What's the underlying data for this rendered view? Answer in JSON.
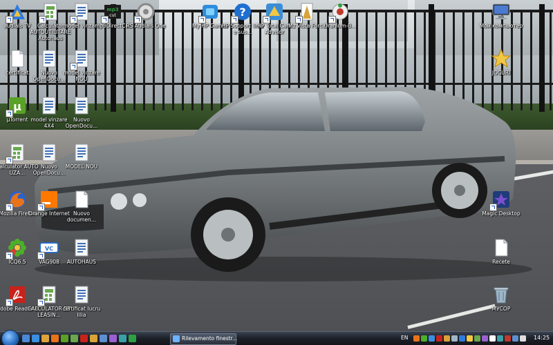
{
  "desktop": {
    "icons": [
      {
        "id": "audials-tv",
        "label": "audials TV",
        "icon": "audials-tv-icon",
        "color": "#2f7be0"
      },
      {
        "id": "calculator-autoutilitare",
        "label": "Calculator AUTOUTILITARE Autohaus",
        "icon": "calculator-icon",
        "color": "#6aa84f"
      },
      {
        "id": "model-vinzare",
        "label": "model vinzare",
        "icon": "document-icon",
        "color": "#3d6fb6"
      },
      {
        "id": "mp3directcut",
        "label": "mp3DirectCut",
        "icon": "mp3-icon",
        "color": "#2ea043"
      },
      {
        "id": "rs-audials-one",
        "label": "RS Audials One",
        "icon": "audials-one-icon",
        "color": "#888888"
      },
      {
        "id": "my-hp-games",
        "label": "My HP Games",
        "icon": "hp-games-icon",
        "color": "#2f8ddb"
      },
      {
        "id": "hp-support",
        "label": "HP Support linia e sus...",
        "icon": "help-icon",
        "color": "#1f6fd1"
      },
      {
        "id": "hp-total-care",
        "label": "HP Total Care Advisor",
        "icon": "hp-care-icon",
        "color": "#3b8ed6"
      },
      {
        "id": "mz-vista-force",
        "label": "Mz Vista Force",
        "icon": "mz-vista-icon",
        "color": "#d9a33a"
      },
      {
        "id": "uranium-backup",
        "label": "Uranium-B...",
        "icon": "uranium-icon",
        "color": "#c0392b"
      },
      {
        "id": "my-computer",
        "label": "Мой компьютер",
        "icon": "computer-icon",
        "color": "#4a7bd0"
      },
      {
        "id": "certificat",
        "label": "certificat",
        "icon": "blank-file-icon",
        "color": "#ffffff"
      },
      {
        "id": "nuovo-opendoc-1",
        "label": "Nuovo OpenDocu...",
        "icon": "document-icon",
        "color": "#3d6fb6"
      },
      {
        "id": "model-vinzare-nou",
        "label": "model vinzare NOU",
        "icon": "document-icon",
        "color": "#3d6fb6"
      },
      {
        "id": "jocuri",
        "label": "JOCURI",
        "icon": "star-icon",
        "color": "#f2c744"
      },
      {
        "id": "utorrent",
        "label": "µTorrent",
        "icon": "utorrent-icon",
        "color": "#5aa127"
      },
      {
        "id": "model-vinzare-4x4",
        "label": "model vinzare 4X4",
        "icon": "document-icon",
        "color": "#3d6fb6"
      },
      {
        "id": "nuovo-opendoc-2",
        "label": "Nuovo OpenDocu...",
        "icon": "document-icon",
        "color": "#3d6fb6"
      },
      {
        "id": "calculator-auto-uza",
        "label": "Calculator AUTO UZA...",
        "icon": "calculator-icon",
        "color": "#6aa84f"
      },
      {
        "id": "nuovo-opendoc-3",
        "label": "Nuovo OpenDocu...",
        "icon": "document-icon",
        "color": "#3d6fb6"
      },
      {
        "id": "model-nou",
        "label": "MODEL NOU",
        "icon": "document-icon",
        "color": "#3d6fb6"
      },
      {
        "id": "mozilla-firefox",
        "label": "Mozilla Firefox",
        "icon": "firefox-icon",
        "color": "#e8731a"
      },
      {
        "id": "orange-internet",
        "label": "Orange Internet",
        "icon": "orange-icon",
        "color": "#ff7900"
      },
      {
        "id": "nuovo-document",
        "label": "Nuovo documen...",
        "icon": "blank-file-icon",
        "color": "#ffffff"
      },
      {
        "id": "magic-desktop",
        "label": "Magic Desktop",
        "icon": "magic-desktop-icon",
        "color": "#7b4fd0"
      },
      {
        "id": "icq",
        "label": "ICQ6.5",
        "icon": "icq-icon",
        "color": "#4caf2a"
      },
      {
        "id": "vag908",
        "label": "VAG908",
        "icon": "vcds-icon",
        "color": "#2b6cc4"
      },
      {
        "id": "autohaus",
        "label": "AUTOHAUS",
        "icon": "document-icon",
        "color": "#3d6fb6"
      },
      {
        "id": "recete",
        "label": "Recete",
        "icon": "blank-file-icon",
        "color": "#ffffff"
      },
      {
        "id": "adobe-reader",
        "label": "Adobe Reader 8",
        "icon": "adobe-reader-icon",
        "color": "#c9221a"
      },
      {
        "id": "calculator-bt-leasing",
        "label": "CALCULATOR BT LEASIN...",
        "icon": "calculator-icon",
        "color": "#6aa84f"
      },
      {
        "id": "certificat-lucru",
        "label": "certificat lucru lilia",
        "icon": "document-icon",
        "color": "#3d6fb6"
      },
      {
        "id": "recycle-bin",
        "label": "МУСОР",
        "icon": "recycle-bin-icon",
        "color": "#9fb6c8"
      }
    ]
  },
  "taskbar": {
    "start_icon": "windows-orb-icon",
    "quick_launch": [
      {
        "icon": "show-desktop-icon",
        "color": "#4b89d8"
      },
      {
        "icon": "ie-icon",
        "color": "#3a8fe0"
      },
      {
        "icon": "media-icon",
        "color": "#e0a23a"
      },
      {
        "icon": "firefox-icon",
        "color": "#e8731a"
      },
      {
        "icon": "utorrent-icon",
        "color": "#5aa127"
      },
      {
        "icon": "app-icon",
        "color": "#6aa84f"
      },
      {
        "icon": "app-icon",
        "color": "#c9221a"
      },
      {
        "icon": "app-icon",
        "color": "#d9a33a"
      },
      {
        "icon": "app-icon",
        "color": "#5d8fd0"
      },
      {
        "icon": "app-icon",
        "color": "#9a5fd0"
      },
      {
        "icon": "app-icon",
        "color": "#3aa0a8"
      },
      {
        "icon": "app-icon",
        "color": "#2ea043"
      }
    ],
    "window_button": {
      "label": "Rilevamento finestr...",
      "icon": "window-icon"
    },
    "language": "EN",
    "tray": [
      {
        "icon": "tray-icon",
        "color": "#e8731a"
      },
      {
        "icon": "tray-icon",
        "color": "#4caf2a"
      },
      {
        "icon": "tray-icon",
        "color": "#3a8fe0"
      },
      {
        "icon": "tray-icon",
        "color": "#c9221a"
      },
      {
        "icon": "tray-icon",
        "color": "#d9a33a"
      },
      {
        "icon": "tray-icon",
        "color": "#9fb6c8"
      },
      {
        "icon": "tray-icon",
        "color": "#2f7be0"
      },
      {
        "icon": "tray-icon",
        "color": "#f2c744"
      },
      {
        "icon": "tray-icon",
        "color": "#6aa84f"
      },
      {
        "icon": "tray-icon",
        "color": "#9a5fd0"
      },
      {
        "icon": "tray-icon",
        "color": "#ffffff"
      },
      {
        "icon": "tray-icon",
        "color": "#3aa0a8"
      },
      {
        "icon": "tray-icon",
        "color": "#c0392b"
      },
      {
        "icon": "tray-icon",
        "color": "#5d8fd0"
      },
      {
        "icon": "volume-icon",
        "color": "#dddddd"
      }
    ],
    "clock": "14:25"
  }
}
